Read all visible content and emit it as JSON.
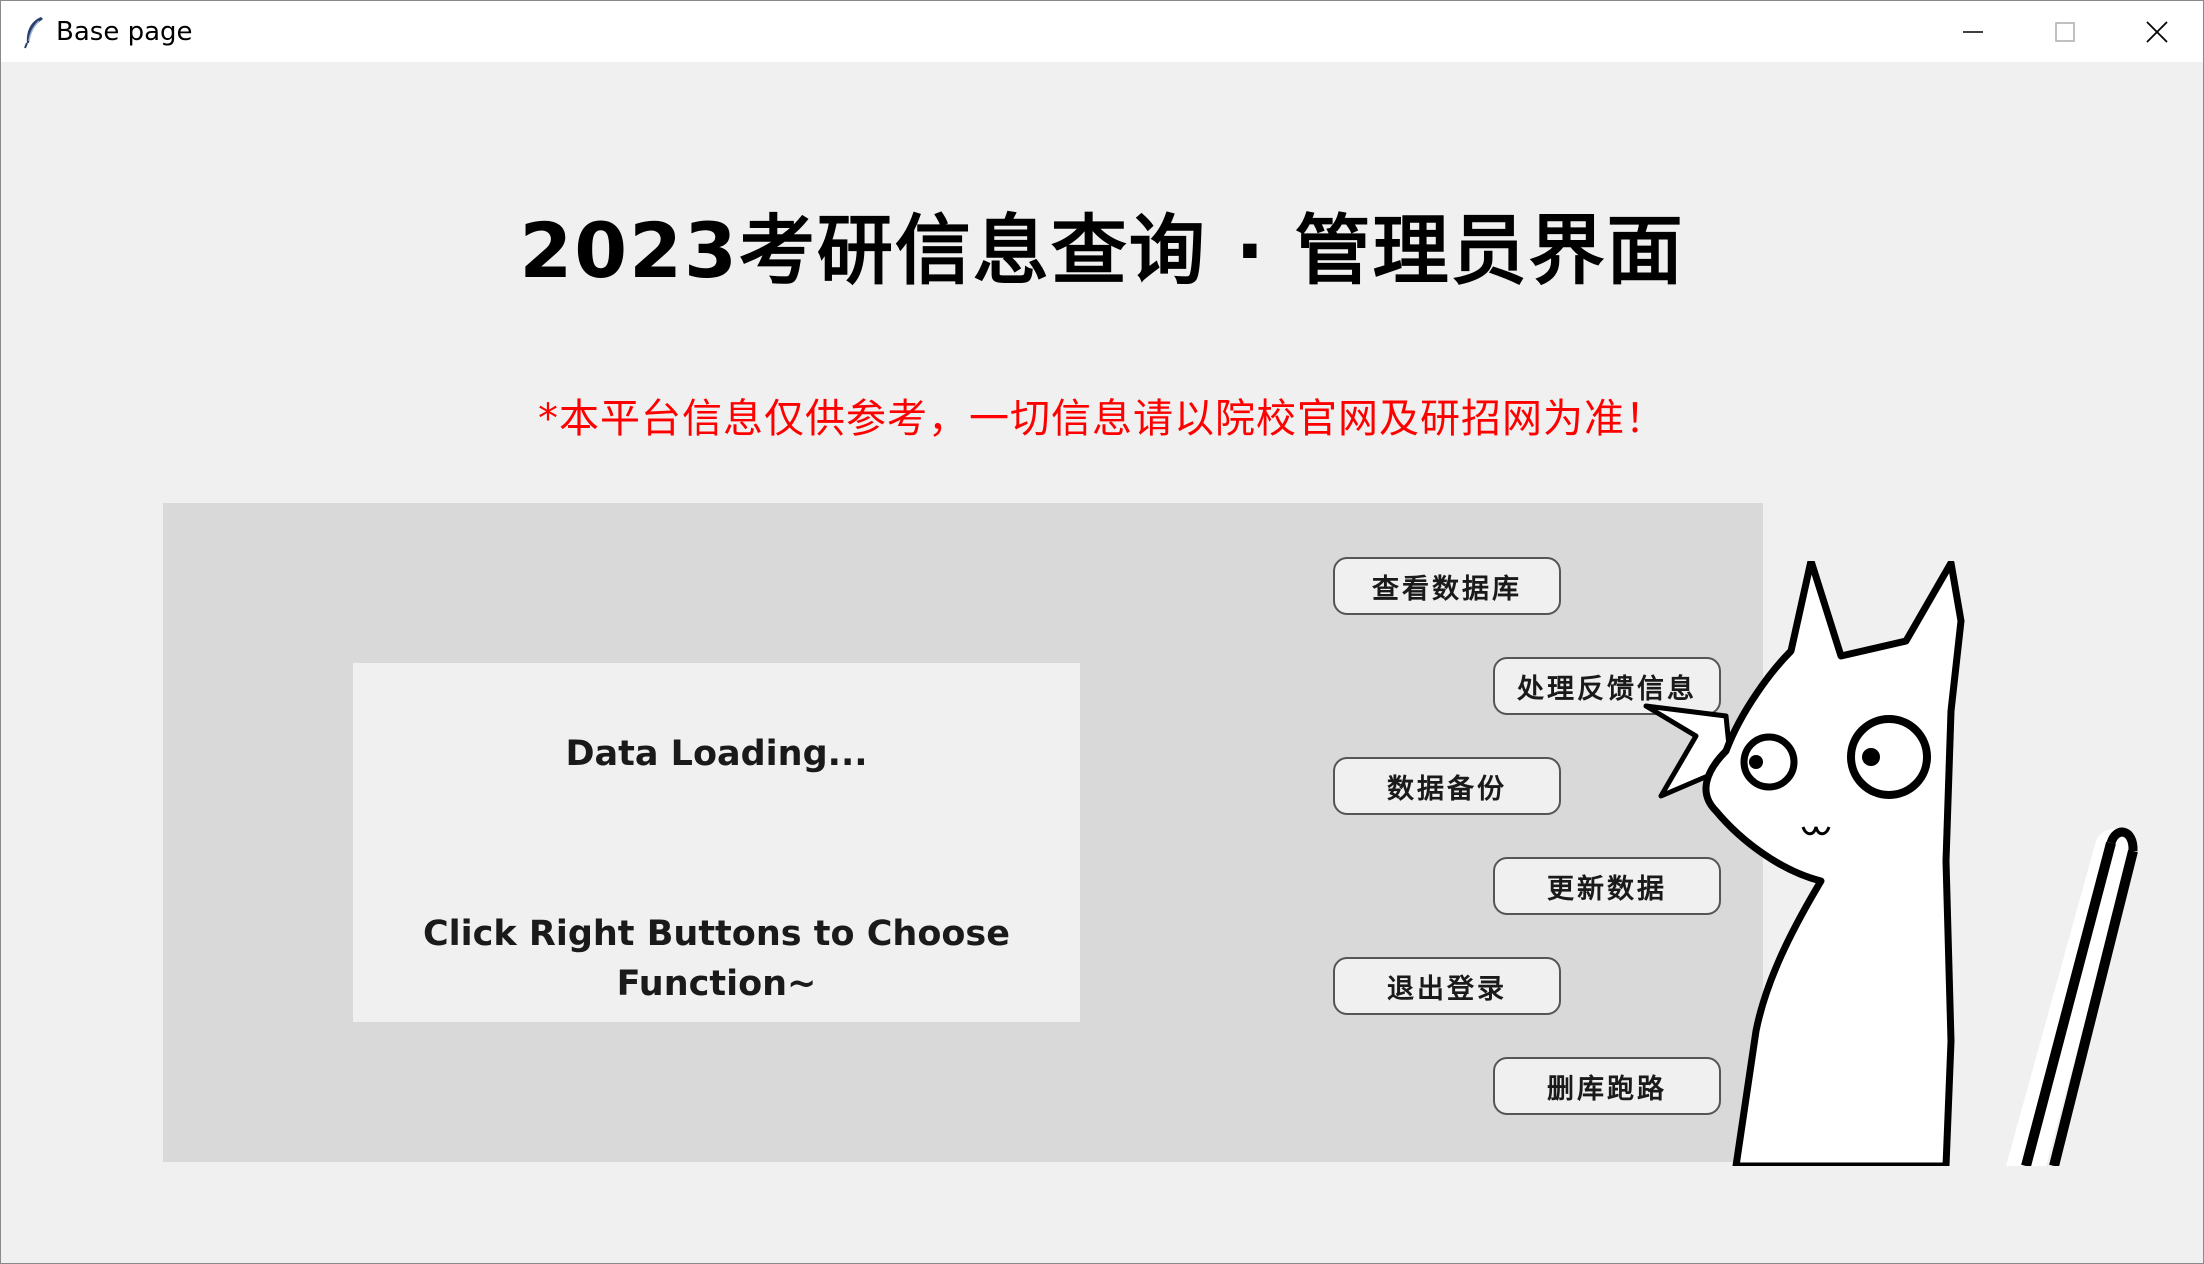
{
  "window": {
    "title": "Base page",
    "controls": {
      "minimize": "minimize-icon",
      "maximize": "maximize-icon",
      "close": "close-icon"
    }
  },
  "header": {
    "title": "2023考研信息查询 · 管理员界面",
    "notice": "*本平台信息仅供参考，一切信息请以院校官网及研招网为准！"
  },
  "infobox": {
    "line1": "Data Loading...",
    "line2": "Click Right Buttons to Choose Function~"
  },
  "buttons": {
    "view_db": "查看数据库",
    "feedback": "处理反馈信息",
    "backup": "数据备份",
    "update": "更新数据",
    "logout": "退出登录",
    "delete_run": "删库跑路"
  },
  "colors": {
    "window_bg": "#f0f0f0",
    "panel_bg": "#d9d9d9",
    "notice": "#ff0000"
  }
}
